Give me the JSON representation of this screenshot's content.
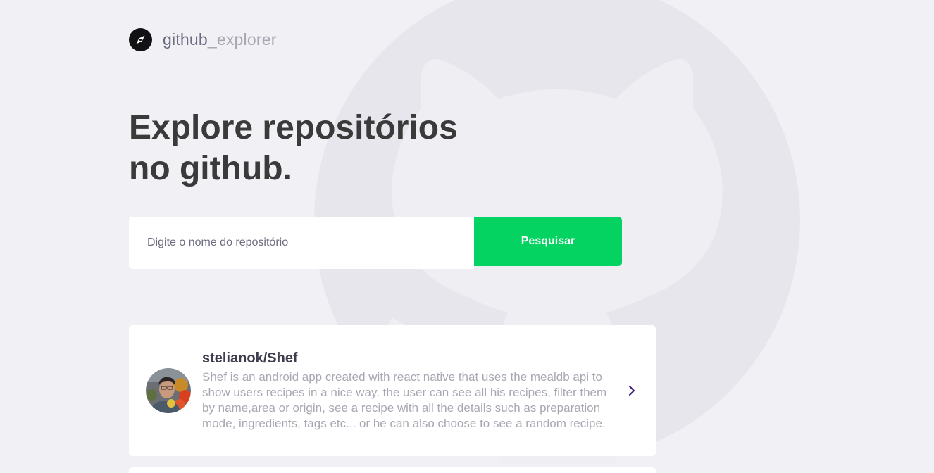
{
  "brand": {
    "icon": "compass-icon",
    "name_part1": "github",
    "name_part2": "_explorer"
  },
  "hero": {
    "title": "Explore repositórios no github."
  },
  "search": {
    "placeholder": "Digite o nome do repositório",
    "value": "",
    "button_label": "Pesquisar"
  },
  "background": {
    "icon": "github-octocat-icon"
  },
  "repositories": [
    {
      "full_name": "stelianok/Shef",
      "description": "Shef is an android app created with react native that uses the mealdb api to show users recipes in a nice way. the user can see all his recipes, filter them by name,area or origin, see a recipe with all the details such as preparation mode, ingredients, tags etc... or he can also choose to see a random recipe.",
      "avatar_icon": "user-avatar",
      "chevron_icon": "chevron-right-icon"
    }
  ],
  "colors": {
    "background": "#f0f0f5",
    "title": "#3a3a3a",
    "accent_green": "#04d361",
    "chevron": "#3d1c7a",
    "muted_text": "#a8a8b3"
  }
}
